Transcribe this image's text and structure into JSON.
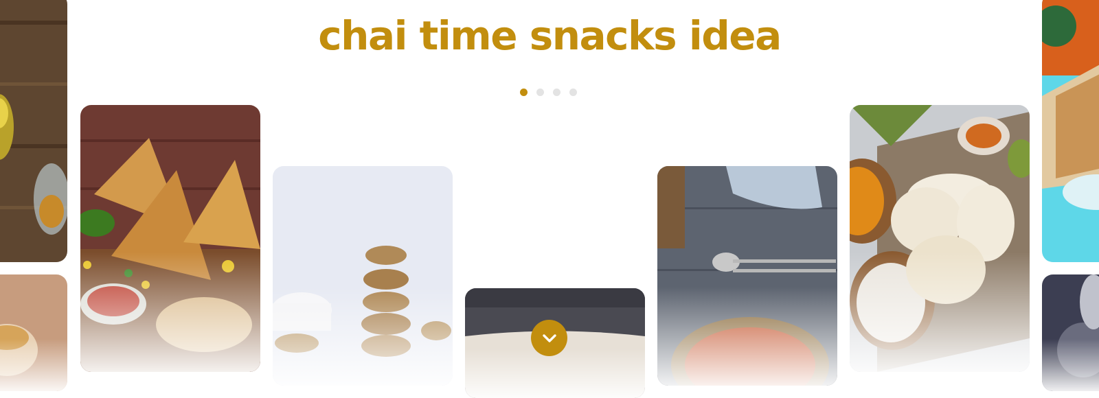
{
  "header": {
    "title": "chai time snacks idea"
  },
  "carousel": {
    "pages": 4,
    "active_page": 1
  },
  "cards": [
    {
      "name": "card-left-top",
      "image": "lassi-glass"
    },
    {
      "name": "card-left-bottom",
      "image": "bread-bun"
    },
    {
      "name": "card-samosa",
      "image": "samosa-plate"
    },
    {
      "name": "card-oat-cookies",
      "image": "oat-cookie-stack"
    },
    {
      "name": "card-dough",
      "image": "dough-sheet"
    },
    {
      "name": "card-halwa",
      "image": "carrot-halwa-bowl"
    },
    {
      "name": "card-idli",
      "image": "idli-chutney-platter"
    },
    {
      "name": "card-right-top",
      "image": "toast-sandwich"
    },
    {
      "name": "card-right-bottom",
      "image": "kettle"
    }
  ],
  "icons": {
    "scroll_down": "chevron-down-icon"
  },
  "colors": {
    "accent": "#c28e0e",
    "dot_inactive": "#e3e3e3",
    "background": "#ffffff"
  }
}
